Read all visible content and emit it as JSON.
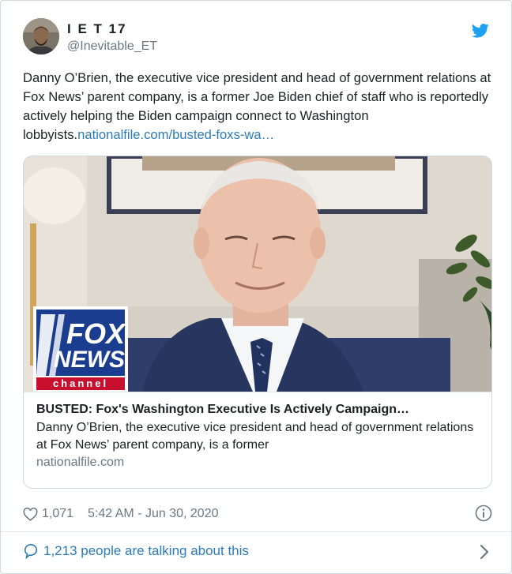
{
  "user": {
    "display_name": "I E T 17",
    "handle": "@Inevitable_ET"
  },
  "tweet": {
    "text": "Danny O’Brien, the executive vice president and head of government relations at Fox News’ parent company, is a former Joe Biden chief of staff who is reportedly actively helping the Biden campaign connect to Washington lobbyists.",
    "link_text": "nationalfile.com/busted-foxs-wa…"
  },
  "card": {
    "image_logo": {
      "line1": "FOX",
      "line2": "NEWS",
      "line3": "channel"
    },
    "title": "BUSTED: Fox's Washington Executive Is Actively Campaign…",
    "description": "Danny O’Brien, the executive vice president and head of government relations at Fox News’ parent company, is a former",
    "domain": "nationalfile.com"
  },
  "meta": {
    "likes": "1,071",
    "timestamp": "5:42 AM - Jun 30, 2020"
  },
  "footer": {
    "talking": "1,213 people are talking about this"
  },
  "icons": {
    "twitter": "twitter-bird-icon",
    "like": "heart-icon",
    "info": "info-icon",
    "reply": "speech-bubble-icon",
    "chevron": "chevron-right-icon"
  },
  "colors": {
    "link": "#2b7bb9",
    "muted": "#697882",
    "fox_blue": "#1a3d8f",
    "fox_red": "#c8102e"
  }
}
